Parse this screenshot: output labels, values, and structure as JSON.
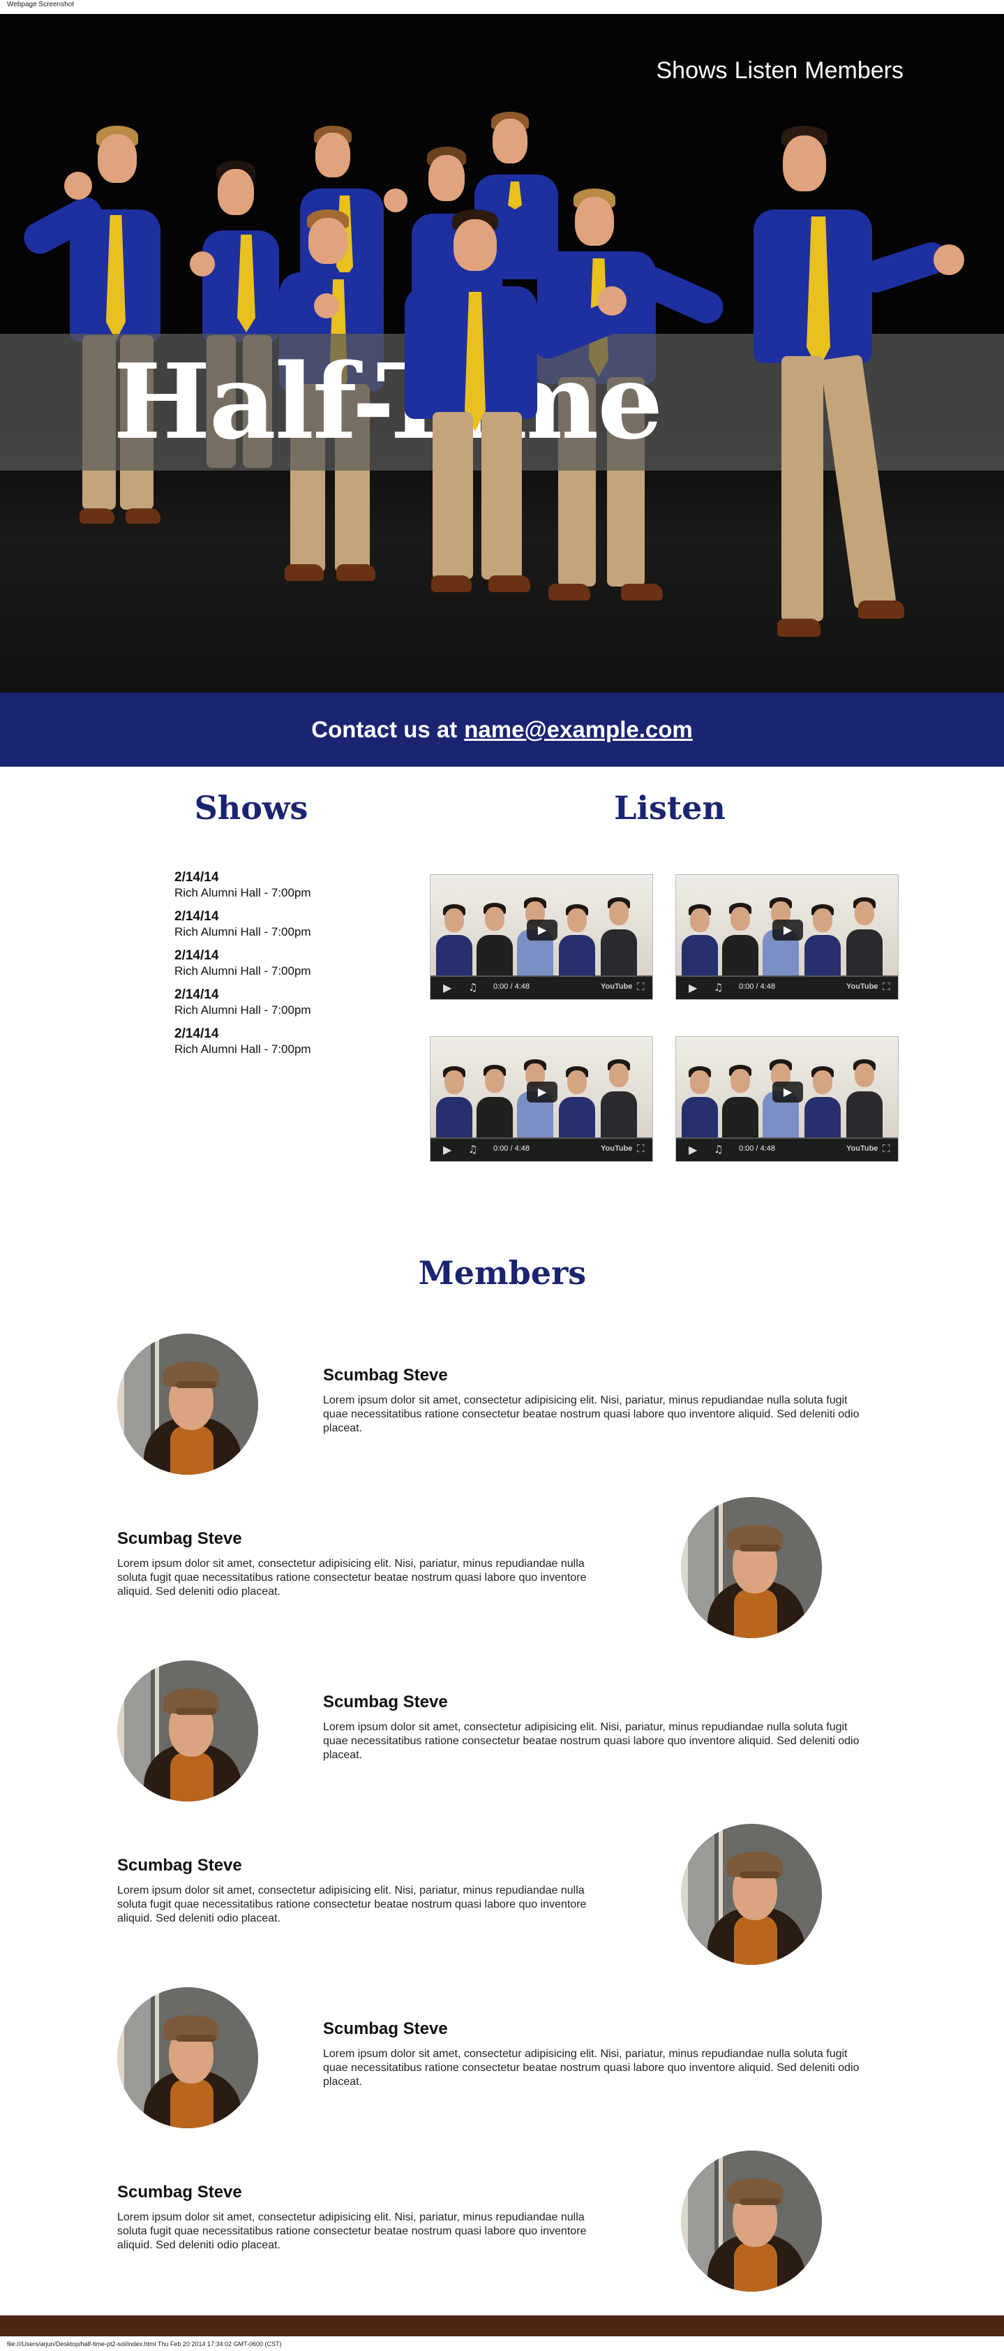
{
  "print": {
    "header": "Webpage Screenshot",
    "footer": "file:///Users/arjun/Desktop/half-time-pt2-sol/index.html Thu Feb 20 2014 17:34:02 GMT-0600 (CST)"
  },
  "nav": {
    "items": [
      {
        "label": "Shows"
      },
      {
        "label": "Listen"
      },
      {
        "label": "Members"
      }
    ]
  },
  "hero": {
    "title": "Half-Time"
  },
  "contact": {
    "prefix": "Contact us at",
    "email": "name@example.com"
  },
  "shows": {
    "heading": "Shows",
    "items": [
      {
        "date": "2/14/14",
        "venue": "Rich Alumni Hall - 7:00pm"
      },
      {
        "date": "2/14/14",
        "venue": "Rich Alumni Hall - 7:00pm"
      },
      {
        "date": "2/14/14",
        "venue": "Rich Alumni Hall - 7:00pm"
      },
      {
        "date": "2/14/14",
        "venue": "Rich Alumni Hall - 7:00pm"
      },
      {
        "date": "2/14/14",
        "venue": "Rich Alumni Hall - 7:00pm"
      }
    ]
  },
  "listen": {
    "heading": "Listen",
    "videos": [
      {
        "current": "0:00",
        "duration": "4:48",
        "brand": "YouTube"
      },
      {
        "current": "0:00",
        "duration": "4:48",
        "brand": "YouTube"
      },
      {
        "current": "0:00",
        "duration": "4:48",
        "brand": "YouTube"
      },
      {
        "current": "0:00",
        "duration": "4:48",
        "brand": "YouTube"
      }
    ]
  },
  "members": {
    "heading": "Members",
    "items": [
      {
        "name": "Scumbag Steve",
        "bio": "Lorem ipsum dolor sit amet, consectetur adipisicing elit. Nisi, pariatur, minus repudiandae nulla soluta fugit quae necessitatibus ratione consectetur beatae nostrum quasi labore quo inventore aliquid. Sed deleniti odio placeat."
      },
      {
        "name": "Scumbag Steve",
        "bio": "Lorem ipsum dolor sit amet, consectetur adipisicing elit. Nisi, pariatur, minus repudiandae nulla soluta fugit quae necessitatibus ratione consectetur beatae nostrum quasi labore quo inventore aliquid. Sed deleniti odio placeat."
      },
      {
        "name": "Scumbag Steve",
        "bio": "Lorem ipsum dolor sit amet, consectetur adipisicing elit. Nisi, pariatur, minus repudiandae nulla soluta fugit quae necessitatibus ratione consectetur beatae nostrum quasi labore quo inventore aliquid. Sed deleniti odio placeat."
      },
      {
        "name": "Scumbag Steve",
        "bio": "Lorem ipsum dolor sit amet, consectetur adipisicing elit. Nisi, pariatur, minus repudiandae nulla soluta fugit quae necessitatibus ratione consectetur beatae nostrum quasi labore quo inventore aliquid. Sed deleniti odio placeat."
      },
      {
        "name": "Scumbag Steve",
        "bio": "Lorem ipsum dolor sit amet, consectetur adipisicing elit. Nisi, pariatur, minus repudiandae nulla soluta fugit quae necessitatibus ratione consectetur beatae nostrum quasi labore quo inventore aliquid. Sed deleniti odio placeat."
      },
      {
        "name": "Scumbag Steve",
        "bio": "Lorem ipsum dolor sit amet, consectetur adipisicing elit. Nisi, pariatur, minus repudiandae nulla soluta fugit quae necessitatibus ratione consectetur beatae nostrum quasi labore quo inventore aliquid. Sed deleniti odio placeat."
      }
    ]
  },
  "colors": {
    "brand_navy": "#1b2470",
    "footer_brown": "#4d2614",
    "shirt_blue": "#1e2fa0",
    "tie_yellow": "#e9c01f"
  }
}
